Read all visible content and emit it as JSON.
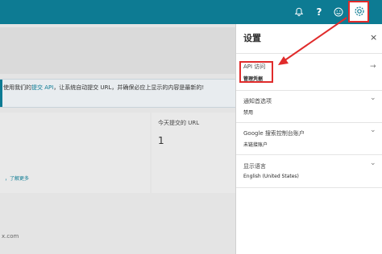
{
  "topbar": {
    "icons": [
      "bell-icon",
      "help-icon",
      "smile-icon",
      "gear-icon"
    ],
    "help_glyph": "?",
    "accent_color": "#0d7b93",
    "highlight_color": "#e02b2b"
  },
  "main": {
    "banner_text_a": "使用我们的",
    "banner_link": "提交 API",
    "banner_text_b": "，让系统自动提交 URL，并确保必应上显示的内容是最新的!",
    "card_link": "，了解更多",
    "card_title": "今天提交的 URL",
    "card_value": "1",
    "footer_text": "x.com"
  },
  "settings": {
    "title": "设置",
    "close": "×",
    "sections": [
      {
        "label": "API 访问",
        "value": "管理凭据",
        "chevron": "→"
      },
      {
        "label": "通知首选项",
        "value": "禁用",
        "chevron": "⌄"
      },
      {
        "label": "Google 搜索控制台账户",
        "value": "未链接账户",
        "chevron": "⌄"
      },
      {
        "label": "显示语言",
        "value": "English (United States)",
        "chevron": "⌄"
      }
    ]
  }
}
